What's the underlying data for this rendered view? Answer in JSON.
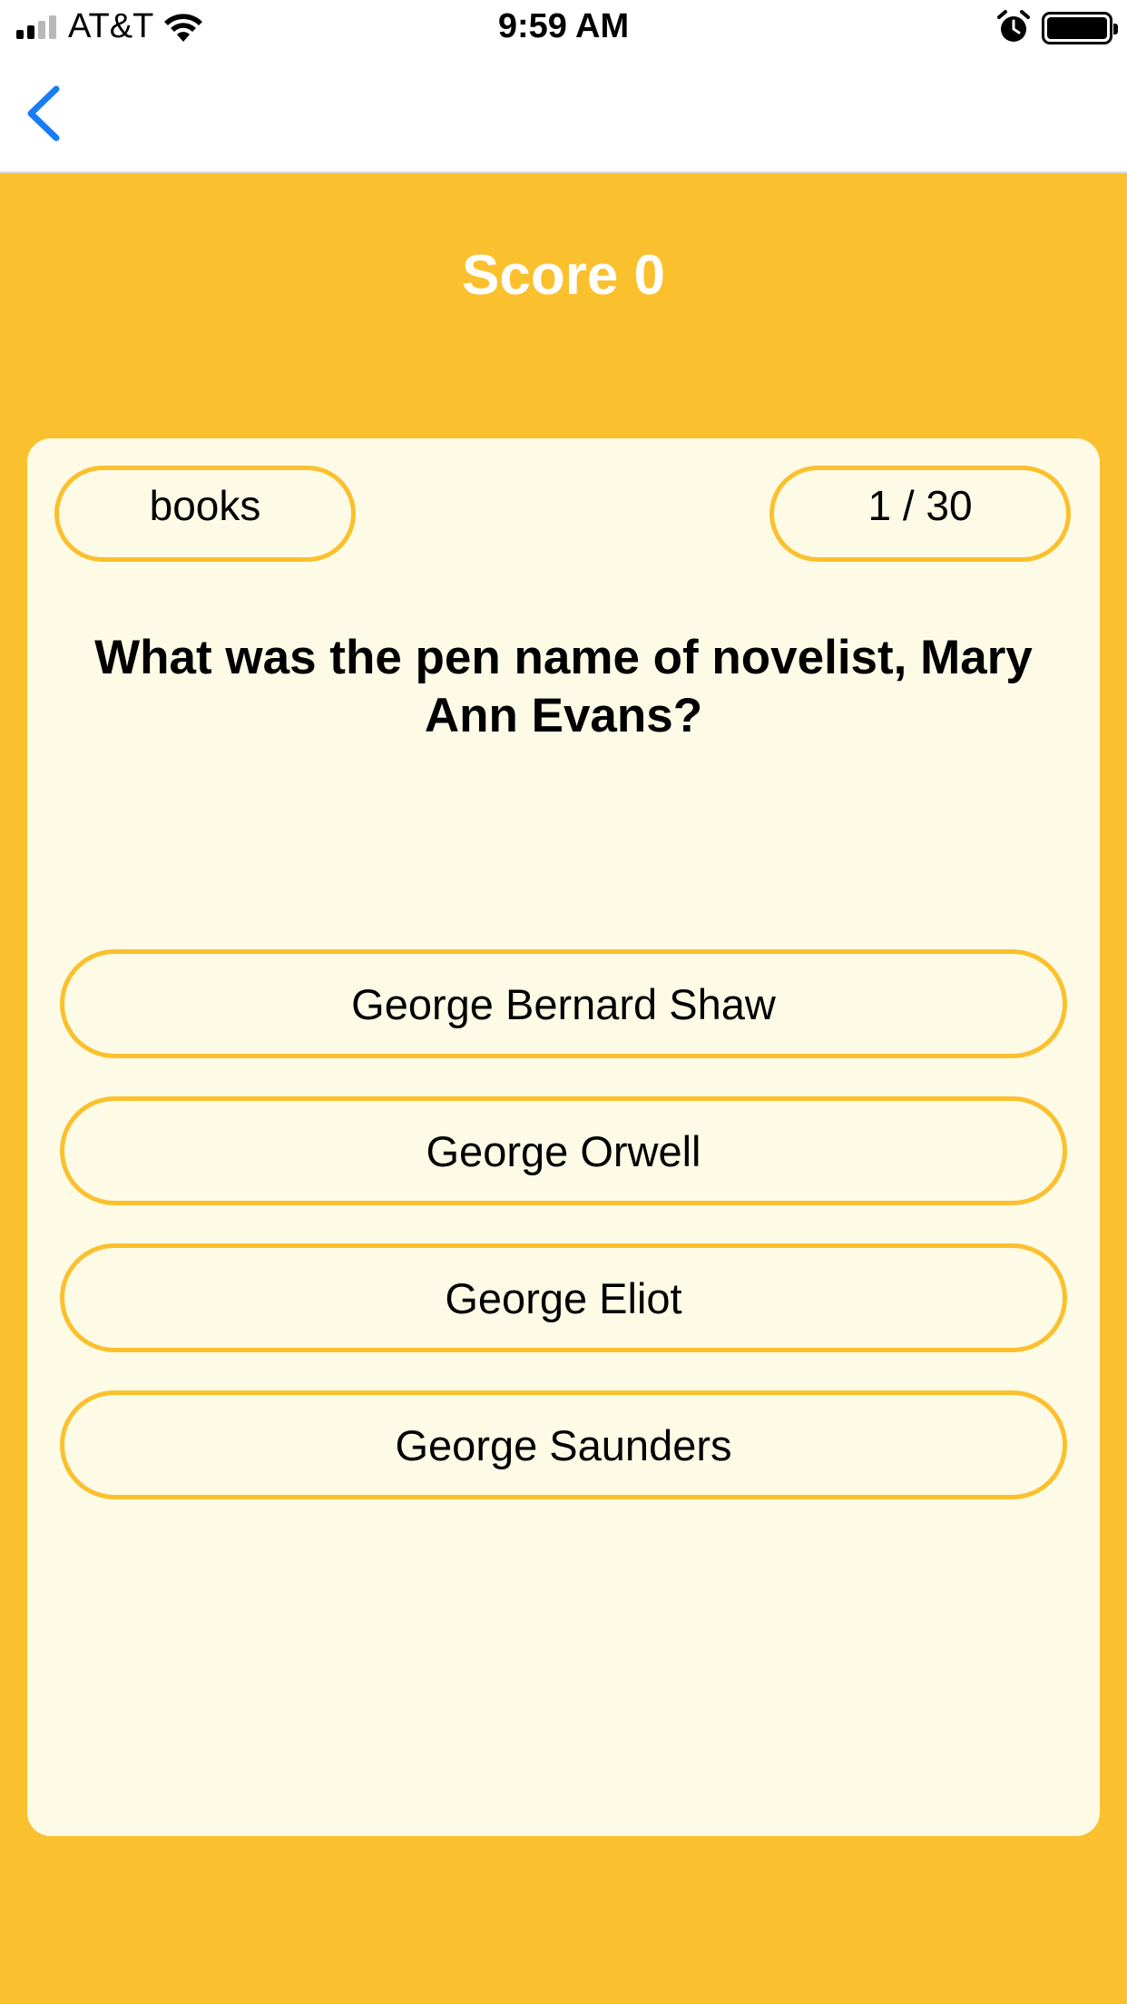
{
  "status_bar": {
    "carrier": "AT&T",
    "time": "9:59 AM",
    "icons": [
      "signal-icon",
      "wifi-icon",
      "alarm-icon",
      "battery-icon"
    ]
  },
  "nav": {
    "back_icon": "chevron-left-icon"
  },
  "score": {
    "label": "Score 0"
  },
  "quiz": {
    "category": "books",
    "progress": "1 / 30",
    "question": "What was the pen name of novelist, Mary Ann Evans?",
    "answers": [
      "George Bernard Shaw",
      "George Orwell",
      "George Eliot",
      "George Saunders"
    ]
  },
  "colors": {
    "accent": "#FBC02D",
    "card_background": "#FDFBE6",
    "nav_tint": "#1A7CF5"
  }
}
